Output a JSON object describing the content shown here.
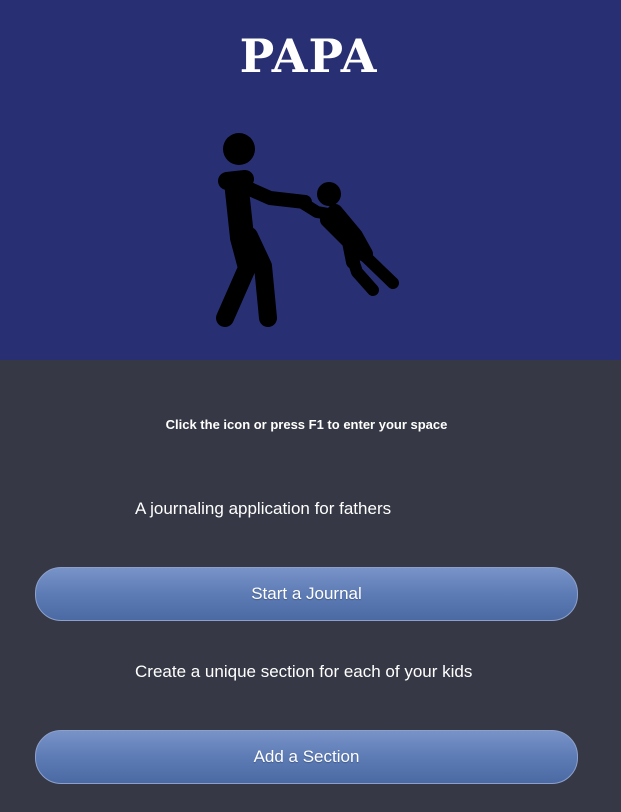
{
  "header": {
    "title": "PAPA",
    "background": "#283073",
    "icon": "father-swinging-child-icon"
  },
  "main": {
    "background": "#363945",
    "hint": "Click the icon or press F1 to enter your space",
    "features": [
      {
        "description": "A journaling application for fathers",
        "button_label": "Start a Journal"
      },
      {
        "description": "Create a unique section for each of your kids",
        "button_label": "Add a Section"
      }
    ]
  },
  "colors": {
    "text": "#ffffff",
    "button_top": "#7893c8",
    "button_bottom": "#4b6aa4"
  }
}
